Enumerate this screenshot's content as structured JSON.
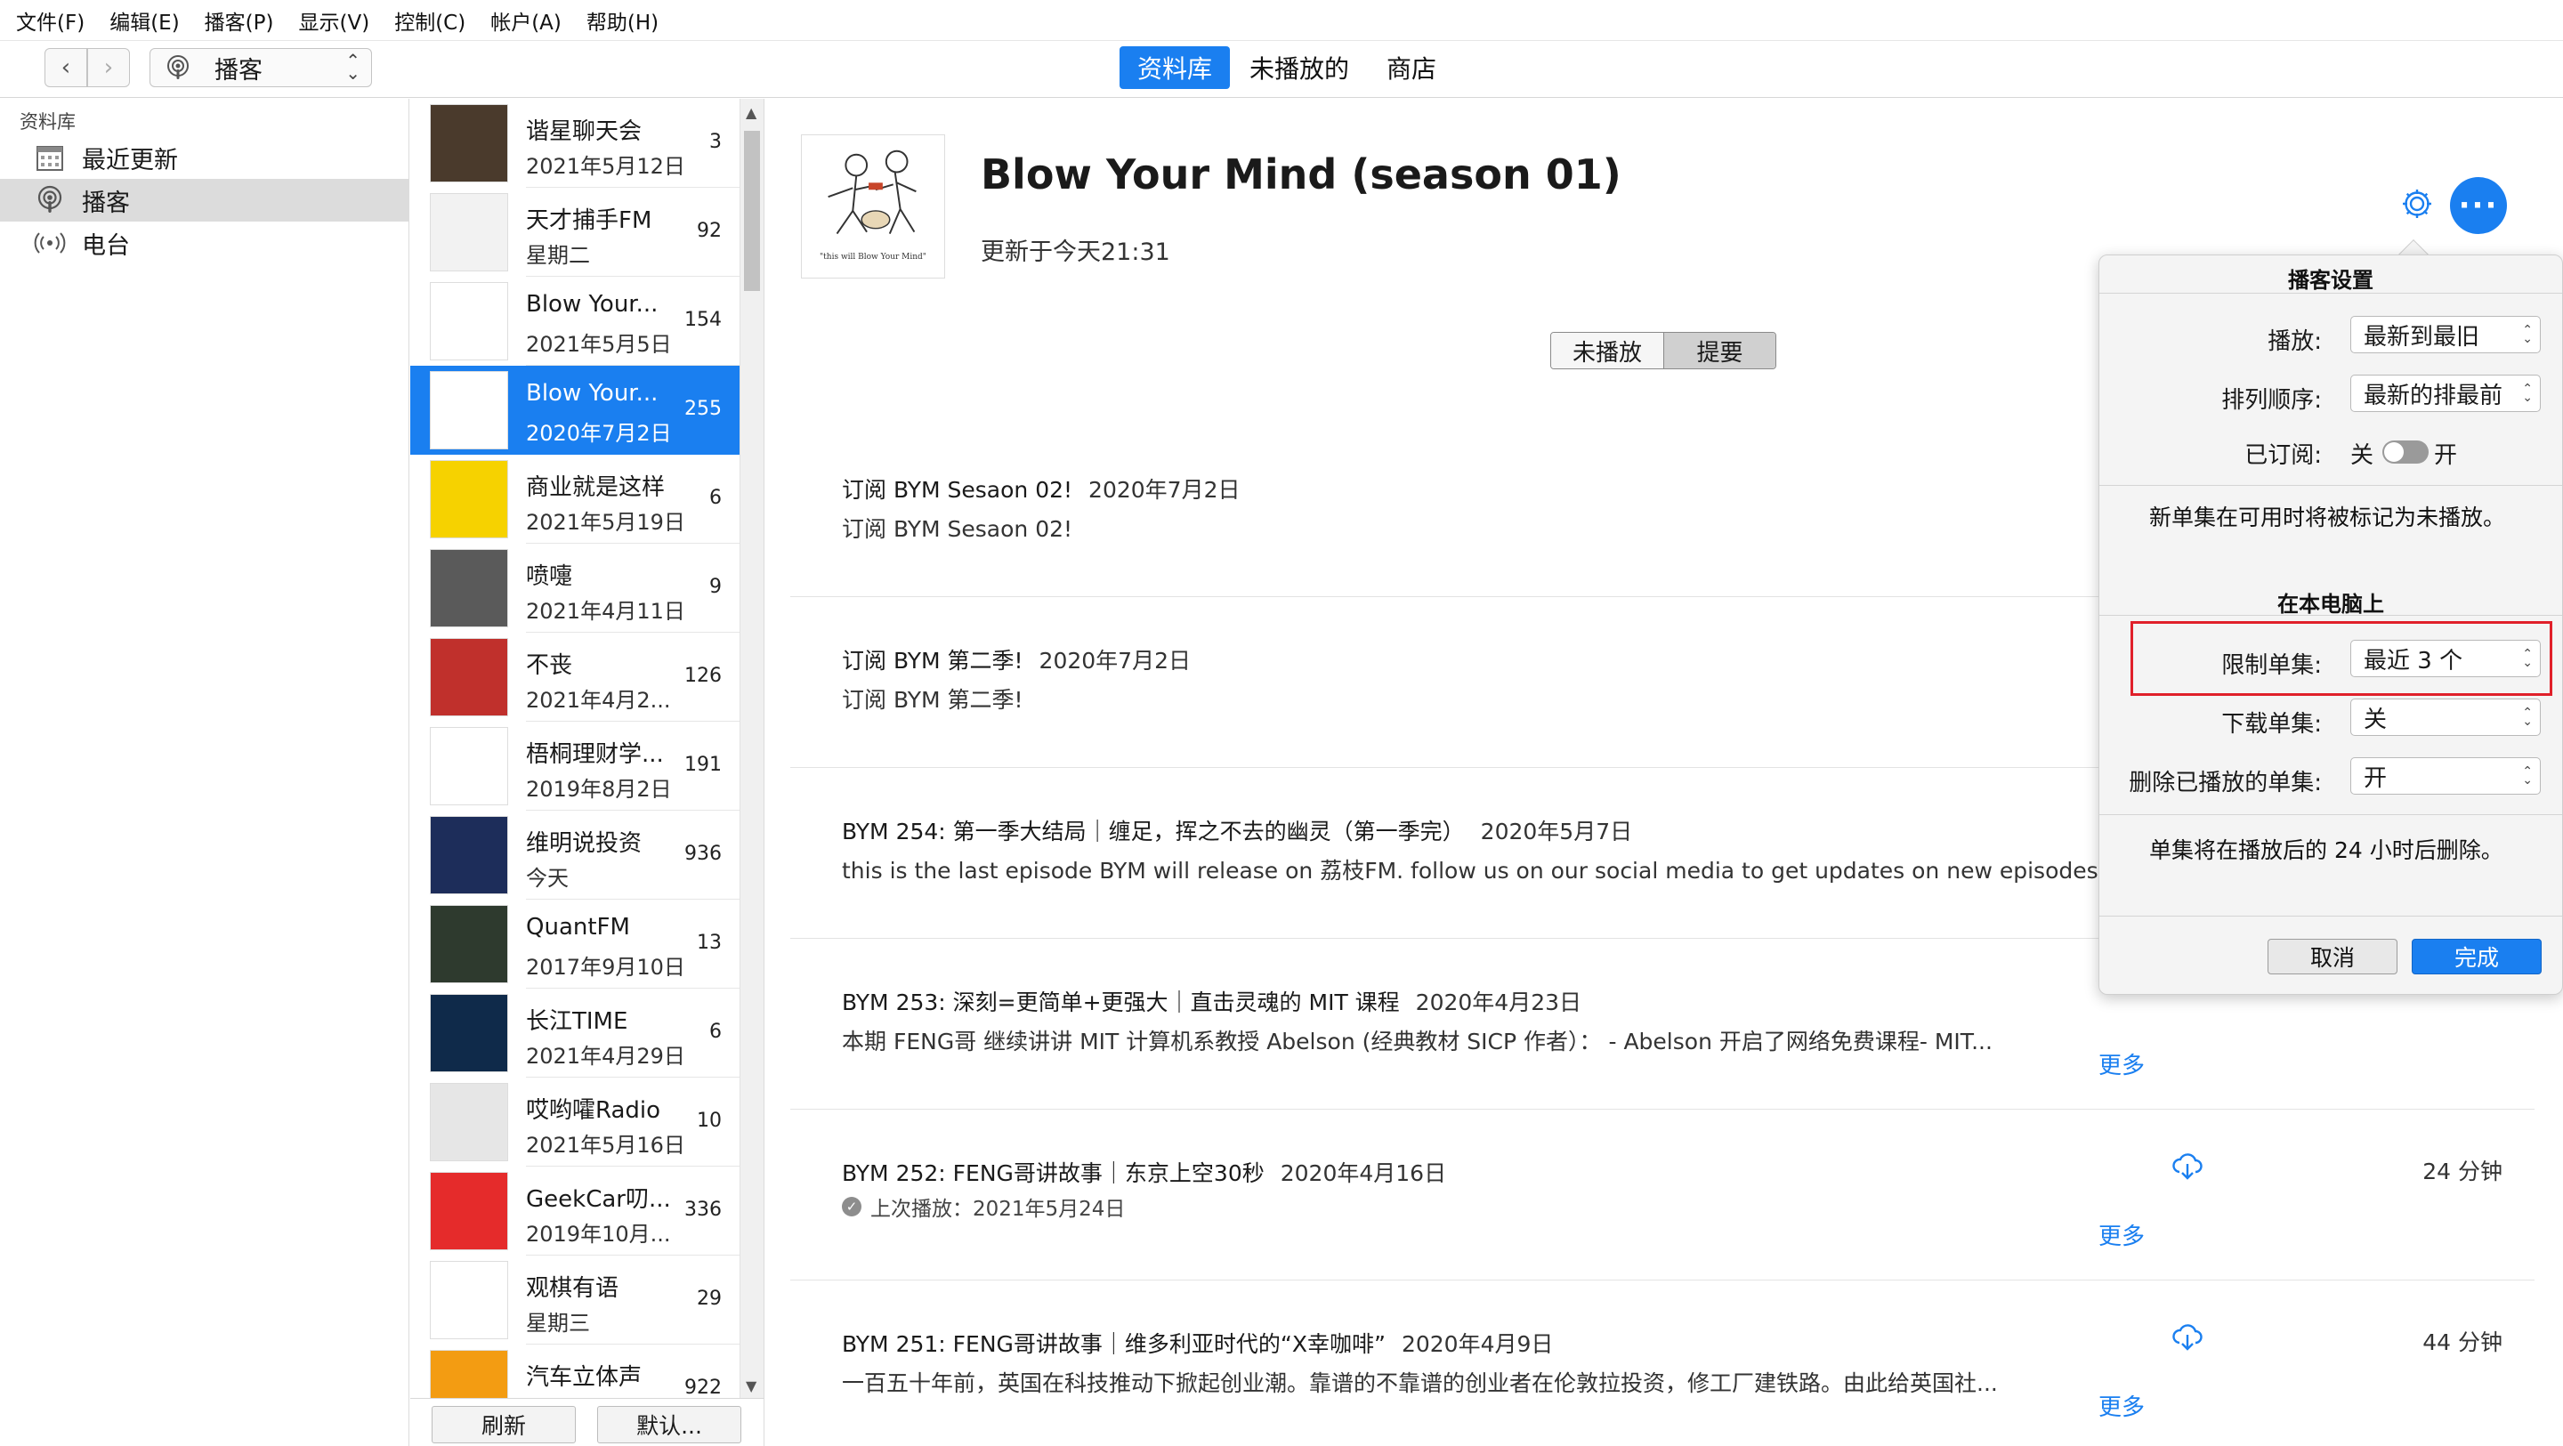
{
  "menu": [
    "文件(F)",
    "编辑(E)",
    "播客(P)",
    "显示(V)",
    "控制(C)",
    "帐户(A)",
    "帮助(H)"
  ],
  "toolbar": {
    "media_kind": "播客",
    "tabs": [
      {
        "label": "资料库",
        "active": true
      },
      {
        "label": "未播放的",
        "active": false
      },
      {
        "label": "商店",
        "active": false
      }
    ]
  },
  "sidebar": {
    "heading": "资料库",
    "items": [
      {
        "label": "最近更新",
        "icon": "calendar-icon",
        "selected": false
      },
      {
        "label": "播客",
        "icon": "podcast-icon",
        "selected": true
      },
      {
        "label": "电台",
        "icon": "radio-icon",
        "selected": false
      }
    ]
  },
  "podcasts": [
    {
      "title": "谐星聊天会",
      "date": "2021年5月12日",
      "count": "3",
      "art": "#4a3a2c"
    },
    {
      "title": "天才捕手FM",
      "date": "星期二",
      "count": "92",
      "art": "#f2f2f2"
    },
    {
      "title": "Blow Your...",
      "date": "2021年5月5日",
      "count": "154",
      "art": "#ffffff"
    },
    {
      "title": "Blow Your...",
      "date": "2020年7月2日",
      "count": "255",
      "art": "#ffffff",
      "selected": true
    },
    {
      "title": "商业就是这样",
      "date": "2021年5月19日",
      "count": "6",
      "art": "#f6d200"
    },
    {
      "title": "喷嚏",
      "date": "2021年4月11日",
      "count": "9",
      "art": "#5a5a5a"
    },
    {
      "title": "不丧",
      "date": "2021年4月2...",
      "count": "126",
      "art": "#c0302c"
    },
    {
      "title": "梧桐理财学...",
      "date": "2019年8月2日",
      "count": "191",
      "art": "#ffffff"
    },
    {
      "title": "维明说投资",
      "date": "今天",
      "count": "936",
      "art": "#1d2d5a"
    },
    {
      "title": "QuantFM",
      "date": "2017年9月10日",
      "count": "13",
      "art": "#2e3a2e"
    },
    {
      "title": "长江TIME",
      "date": "2021年4月29日",
      "count": "6",
      "art": "#0f2a4a"
    },
    {
      "title": "哎哟嚯Radio",
      "date": "2021年5月16日",
      "count": "10",
      "art": "#e6e6e6"
    },
    {
      "title": "GeekCar叨...",
      "date": "2019年10月...",
      "count": "336",
      "art": "#e52b2b"
    },
    {
      "title": "观棋有语",
      "date": "星期三",
      "count": "29",
      "art": "#ffffff"
    },
    {
      "title": "汽车立体声",
      "date": "",
      "count": "922",
      "art": "#f39c12"
    }
  ],
  "list_footer": {
    "refresh": "刷新",
    "defaults": "默认..."
  },
  "detail": {
    "title": "Blow Your Mind (season 01)",
    "updated": "更新于今天21:31",
    "cover_text": "\"this will Blow Your Mind\"",
    "segment": [
      {
        "label": "未播放",
        "on": false
      },
      {
        "label": "提要",
        "on": true
      }
    ],
    "more_link": "更多",
    "episodes": [
      {
        "title": "订阅 BYM Sesaon 02!",
        "date": "2020年7月2日",
        "desc": "订阅 BYM Sesaon 02!",
        "played": "",
        "duration": "",
        "more": false,
        "cloud": false
      },
      {
        "title": "订阅 BYM 第二季!",
        "date": "2020年7月2日",
        "desc": "订阅 BYM 第二季!",
        "played": "",
        "duration": "",
        "more": false,
        "cloud": false
      },
      {
        "title": "BYM 254: 第一季大结局｜缠足，挥之不去的幽灵（第一季完）",
        "date": "2020年5月7日",
        "desc": "this is the last episode BYM will release on 荔枝FM. follow us on our social media to get updates on new episodes.",
        "played": "",
        "duration": "",
        "more": false,
        "cloud": false
      },
      {
        "title": "BYM 253: 深刻=更简单+更强大｜直击灵魂的 MIT 课程",
        "date": "2020年4月23日",
        "desc": "本期 FENG哥 继续讲讲 MIT 计算机系教授 Abelson (经典教材 SICP 作者）： - Abelson 开启了网络免费课程- MIT...",
        "played": "",
        "duration": "",
        "more": true,
        "cloud": false
      },
      {
        "title": "BYM 252: FENG哥讲故事｜东京上空30秒",
        "date": "2020年4月16日",
        "desc": "",
        "played": "上次播放：2021年5月24日",
        "duration": "24 分钟",
        "more": true,
        "cloud": true
      },
      {
        "title": "BYM 251: FENG哥讲故事｜维多利亚时代的“X幸咖啡”",
        "date": "2020年4月9日",
        "desc": "一百五十年前，英国在科技推动下掀起创业潮。靠谱的不靠谱的创业者在伦敦拉投资，修工厂建铁路。由此给英国社...",
        "played": "",
        "duration": "44 分钟",
        "more": true,
        "cloud": true
      }
    ]
  },
  "popover": {
    "header": "播客设置",
    "play_label": "播放:",
    "play_value": "最新到最旧",
    "order_label": "排列顺序:",
    "order_value": "最新的排最前",
    "subscribed_label": "已订阅:",
    "subscribed_off": "关",
    "subscribed_on": "开",
    "note1": "新单集在可用时将被标记为未播放。",
    "section2": "在本电脑上",
    "limit_label": "限制单集:",
    "limit_value": "最近 3 个",
    "download_label": "下载单集:",
    "download_value": "关",
    "delete_label": "删除已播放的单集:",
    "delete_value": "开",
    "note2": "单集将在播放后的 24 小时后删除。",
    "cancel": "取消",
    "done": "完成"
  },
  "colors": {
    "accent": "#1a7ff0",
    "highlight": "#e0202a"
  }
}
